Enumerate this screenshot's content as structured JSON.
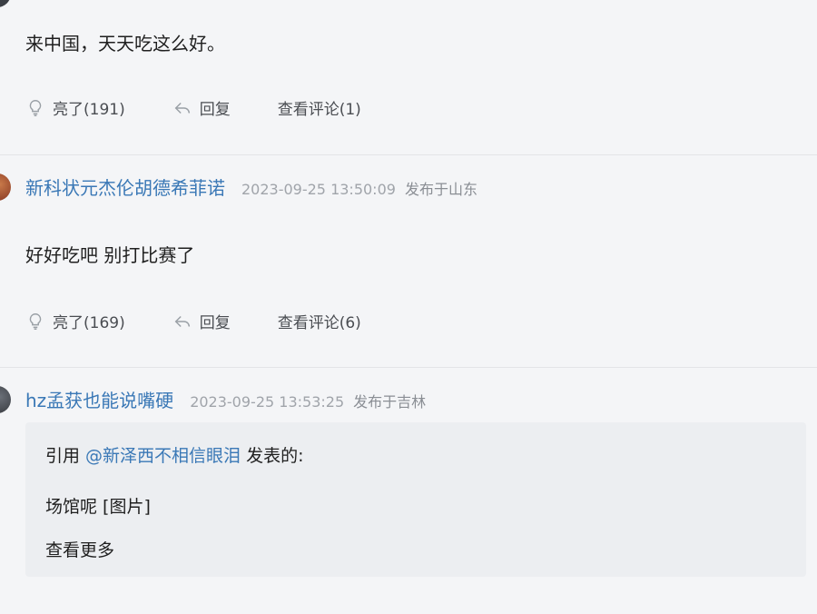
{
  "posts": [
    {
      "content": "来中国，天天吃这么好。",
      "actions": {
        "like_label": "亮了(191)",
        "reply_label": "回复",
        "comments_label": "查看评论(1)"
      }
    },
    {
      "username": "新科状元杰伦胡德希菲诺",
      "timestamp": "2023-09-25 13:50:09",
      "location": "发布于山东",
      "content": "好好吃吧 别打比赛了",
      "actions": {
        "like_label": "亮了(169)",
        "reply_label": "回复",
        "comments_label": "查看评论(6)"
      }
    },
    {
      "username": "hz孟获也能说嘴硬",
      "timestamp": "2023-09-25 13:53:25",
      "location": "发布于吉林",
      "quote": {
        "prefix": "引用 ",
        "quoted_user": "@新泽西不相信眼泪",
        "suffix": " 发表的:",
        "content": "场馆呢 [图片]",
        "more_label": "查看更多"
      }
    }
  ],
  "colors": {
    "link": "#3a78b6",
    "meta": "#a0a4aa",
    "background": "#f4f5f7"
  },
  "icons": {
    "like": "lightbulb-icon",
    "reply": "reply-arrow-icon"
  }
}
